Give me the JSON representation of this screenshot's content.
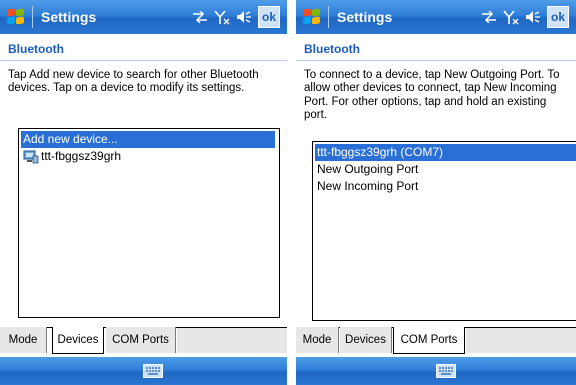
{
  "screens": [
    {
      "title": "Settings",
      "ok_label": "ok",
      "section": "Bluetooth",
      "description": "Tap Add new device to search for other Bluetooth devices. Tap on a device to modify its settings.",
      "items": [
        {
          "label": "Add new device...",
          "selected": true,
          "icon": ""
        },
        {
          "label": "ttt-fbggsz39grh",
          "selected": false,
          "icon": "bluetooth-computer-icon"
        }
      ],
      "tabs": [
        "Mode",
        "Devices",
        "COM Ports"
      ],
      "active_tab": "Devices"
    },
    {
      "title": "Settings",
      "ok_label": "ok",
      "section": "Bluetooth",
      "description": "To connect to a device, tap New Outgoing Port. To allow other devices to connect, tap New Incoming Port. For other options, tap and hold an existing port.",
      "items": [
        {
          "label": "ttt-fbggsz39grh (COM7)",
          "selected": true
        },
        {
          "label": "New Outgoing Port",
          "selected": false
        },
        {
          "label": "New Incoming Port",
          "selected": false
        }
      ],
      "tabs": [
        "Mode",
        "Devices",
        "COM Ports"
      ],
      "active_tab": "COM Ports"
    }
  ],
  "icons": {
    "start": "windows-flag-icon",
    "connectivity": "connectivity-arrows-icon",
    "signal": "no-signal-icon",
    "volume": "volume-icon",
    "input": "keyboard-icon"
  },
  "colors": {
    "titlebar": "#2f7fd8",
    "accent_text": "#1c5cbe",
    "selection": "#2a6fd6"
  }
}
